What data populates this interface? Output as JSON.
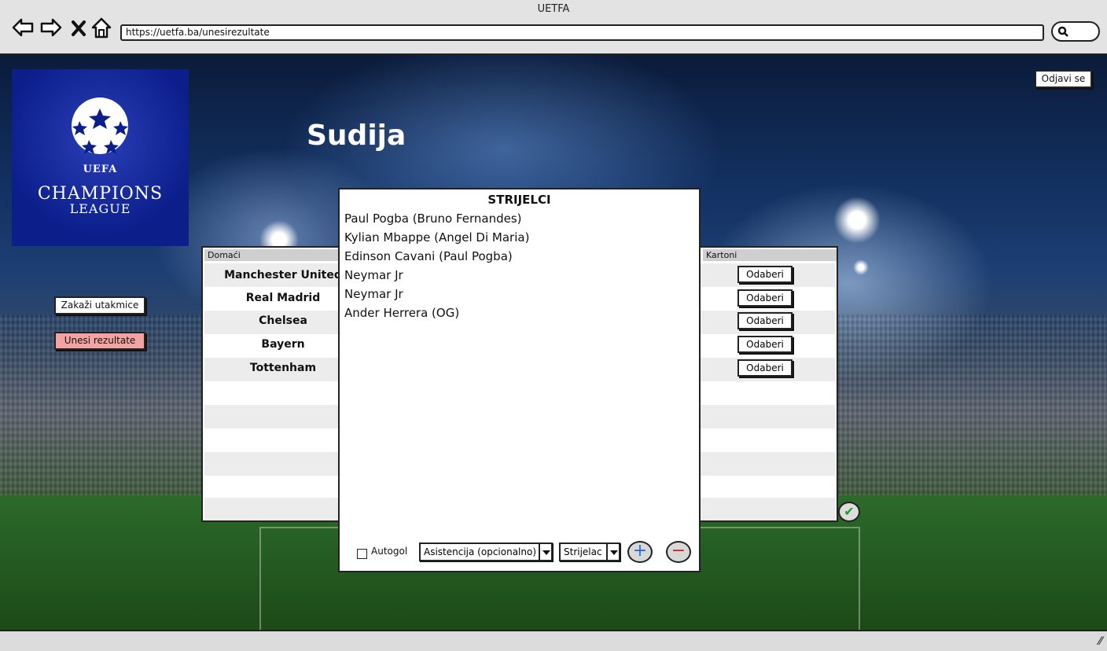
{
  "browser": {
    "title": "UETFA",
    "url": "https://uetfa.ba/unesirezultate",
    "icons": [
      "back-arrow-icon",
      "forward-arrow-icon",
      "close-icon",
      "home-icon",
      "search-icon"
    ]
  },
  "header": {
    "logo": {
      "line_uefa": "UEFA",
      "line1": "CHAMPIONS",
      "line2": "LEAGUE"
    },
    "page_title": "Sudija",
    "logout_label": "Odjavi se"
  },
  "sidebar": {
    "schedule_label": "Zakaži utakmice",
    "results_label": "Unesi rezultate"
  },
  "table": {
    "col_home": "Domaći",
    "col_cards": "Kartoni",
    "rows": [
      {
        "home": "Manchester United",
        "cards_label": "Odaberi"
      },
      {
        "home": "Real Madrid",
        "cards_label": "Odaberi"
      },
      {
        "home": "Chelsea",
        "cards_label": "Odaberi"
      },
      {
        "home": "Bayern",
        "cards_label": "Odaberi"
      },
      {
        "home": "Tottenham",
        "cards_label": "Odaberi"
      }
    ]
  },
  "modal": {
    "title": "STRIJELCI",
    "scorers": [
      "Paul Pogba (Bruno Fernandes)",
      "Kylian Mbappe (Angel Di Maria)",
      "Edinson Cavani (Paul Pogba)",
      "Neymar Jr",
      "Neymar Jr",
      "Ander Herrera (OG)"
    ],
    "autogol_label": "Autogol",
    "assist_select": "Asistencija (opcionalno)",
    "scorer_select": "Strijelac",
    "add_symbol": "+",
    "remove_symbol": "−"
  },
  "colors": {
    "results_button_bg": "#f4a3a3",
    "logo_bg": "#0b1e8a",
    "add_symbol": "#2a6adf",
    "remove_symbol": "#d02020",
    "confirm_check": "#1a9a2a"
  }
}
